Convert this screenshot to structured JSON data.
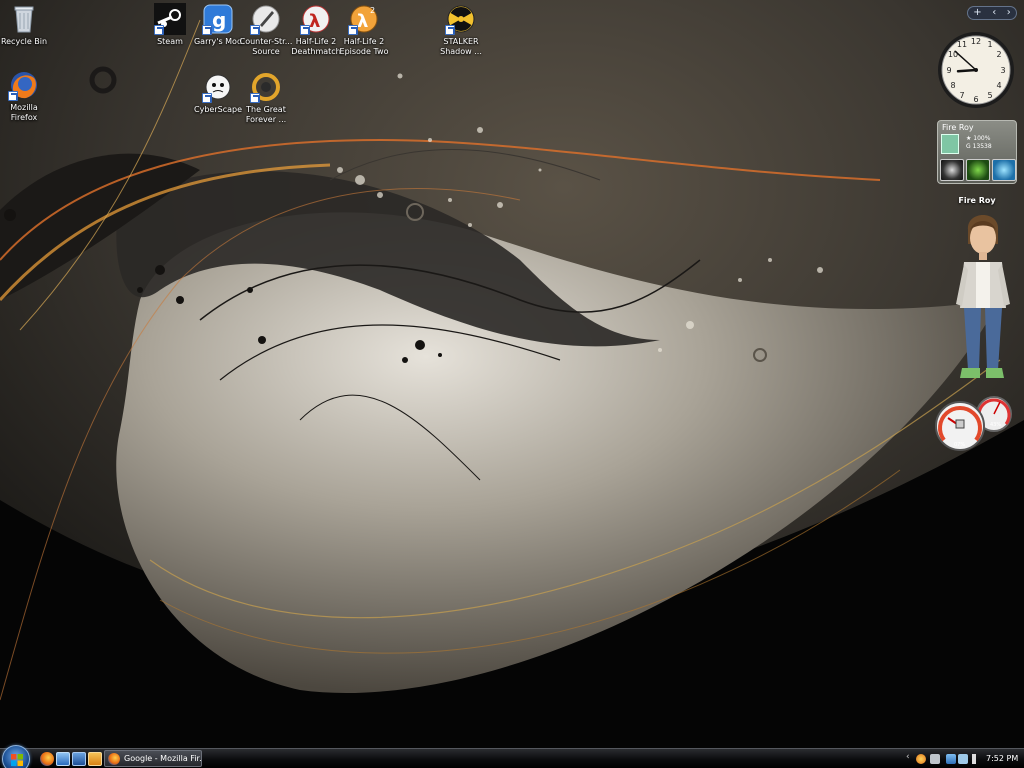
{
  "desktop": {
    "icons": [
      {
        "label": "Recycle Bin",
        "icon": "recycle-bin-icon"
      },
      {
        "label": "Mozilla\nFirefox",
        "icon": "firefox-icon"
      },
      {
        "label": "Steam",
        "icon": "steam-icon"
      },
      {
        "label": "Garry's Mod",
        "icon": "garrys-mod-icon"
      },
      {
        "label": "Counter-Str...\nSource",
        "icon": "counter-strike-icon"
      },
      {
        "label": "Half-Life 2\nDeathmatch",
        "icon": "half-life-icon"
      },
      {
        "label": "Half-Life 2\nEpisode Two",
        "icon": "half-life-episode-two-icon"
      },
      {
        "label": "STALKER\nShadow ...",
        "icon": "stalker-icon"
      },
      {
        "label": "CyberScape",
        "icon": "cyberscape-icon"
      },
      {
        "label": "The Great\nForever ...",
        "icon": "the-great-forever-icon"
      }
    ]
  },
  "sidebar": {
    "controls": [
      "+",
      "‹",
      "›"
    ],
    "clock": {
      "hour": 8,
      "minute": 52
    },
    "xbox": {
      "gamertag": "Fire Roy",
      "rep": "100%",
      "gamerscore": "13538",
      "games": [
        "gears-game-icon",
        "green-star-game-icon",
        "halo-game-icon"
      ]
    },
    "avatar": {
      "name": "Fire Roy"
    },
    "meters": {
      "cpu": "07%",
      "ram": "43%"
    }
  },
  "taskbar": {
    "start": "start-button",
    "quick_launch": [
      "firefox-icon",
      "show-desktop-icon",
      "switch-windows-icon",
      "media-player-icon"
    ],
    "tasks": [
      {
        "label": "Google - Mozilla Fir...",
        "icon": "firefox-icon"
      }
    ],
    "tray": {
      "time": "7:52 PM"
    }
  },
  "colors": {
    "accent": "#f1a23a",
    "wallpaper_dark": "#262421",
    "wallpaper_light": "#cfcac0"
  }
}
